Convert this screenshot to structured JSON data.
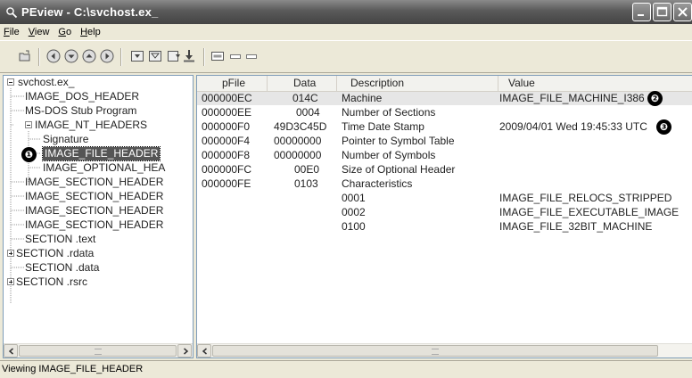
{
  "window": {
    "title": "PEview - C:\\svchost.ex_"
  },
  "menu": [
    {
      "label": "File",
      "accel": "F",
      "rest": "ile"
    },
    {
      "label": "View",
      "accel": "V",
      "rest": "iew"
    },
    {
      "label": "Go",
      "accel": "G",
      "rest": "o"
    },
    {
      "label": "Help",
      "accel": "H",
      "rest": "elp"
    }
  ],
  "toolbar": {
    "icons": [
      "open-file-icon",
      "go-back-icon",
      "go-down-icon",
      "go-up-icon",
      "go-forward-icon",
      "view-byte-icon",
      "view-word-icon",
      "view-dword-icon",
      "view-qword-icon",
      "address-mode-icon",
      "display-mode-1-icon",
      "display-mode-2-icon"
    ]
  },
  "tree": {
    "root": "svchost.ex_",
    "items": [
      {
        "label": "IMAGE_DOS_HEADER"
      },
      {
        "label": "MS-DOS Stub Program"
      },
      {
        "label": "IMAGE_NT_HEADERS"
      },
      {
        "label": "Signature"
      },
      {
        "label": "IMAGE_FILE_HEADER"
      },
      {
        "label": "IMAGE_OPTIONAL_HEA"
      },
      {
        "label": "IMAGE_SECTION_HEADER"
      },
      {
        "label": "IMAGE_SECTION_HEADER"
      },
      {
        "label": "IMAGE_SECTION_HEADER"
      },
      {
        "label": "IMAGE_SECTION_HEADER"
      },
      {
        "label": "SECTION .text"
      },
      {
        "label": "SECTION .rdata"
      },
      {
        "label": "SECTION .data"
      },
      {
        "label": "SECTION .rsrc"
      }
    ]
  },
  "grid": {
    "columns": [
      "pFile",
      "Data",
      "Description",
      "Value"
    ],
    "rows": [
      {
        "pfile": "000000EC",
        "data": "014C",
        "desc": "Machine",
        "value": "IMAGE_FILE_MACHINE_I386"
      },
      {
        "pfile": "000000EE",
        "data": "0004",
        "desc": "Number of Sections",
        "value": ""
      },
      {
        "pfile": "000000F0",
        "data": "49D3C45D",
        "desc": "Time Date Stamp",
        "value": "2009/04/01 Wed 19:45:33 UTC"
      },
      {
        "pfile": "000000F4",
        "data": "00000000",
        "desc": "Pointer to Symbol Table",
        "value": ""
      },
      {
        "pfile": "000000F8",
        "data": "00000000",
        "desc": "Number of Symbols",
        "value": ""
      },
      {
        "pfile": "000000FC",
        "data": "00E0",
        "desc": "Size of Optional Header",
        "value": ""
      },
      {
        "pfile": "000000FE",
        "data": "0103",
        "desc": "Characteristics",
        "value": ""
      },
      {
        "pfile": "",
        "data": "",
        "desc": "0001",
        "value": "IMAGE_FILE_RELOCS_STRIPPED"
      },
      {
        "pfile": "",
        "data": "",
        "desc": "0002",
        "value": "IMAGE_FILE_EXECUTABLE_IMAGE"
      },
      {
        "pfile": "",
        "data": "",
        "desc": "0100",
        "value": "IMAGE_FILE_32BIT_MACHINE"
      }
    ]
  },
  "callouts": [
    "❶",
    "❷",
    "❸"
  ],
  "status": {
    "text": "Viewing IMAGE_FILE_HEADER"
  }
}
